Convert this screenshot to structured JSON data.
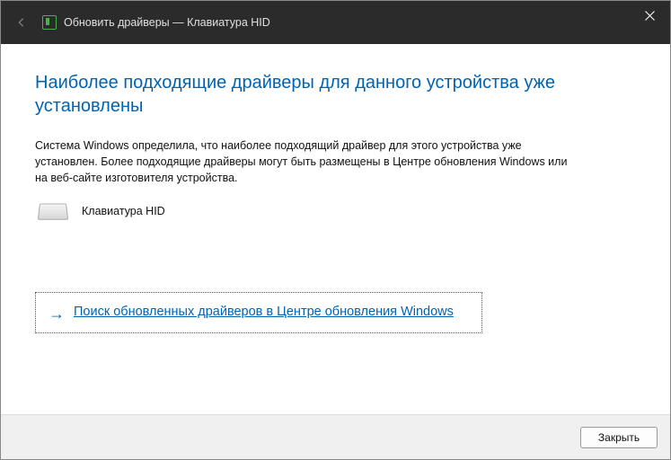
{
  "titlebar": {
    "title": "Обновить драйверы — Клавиатура HID"
  },
  "main": {
    "heading": "Наиболее подходящие драйверы для данного устройства уже установлены",
    "description": "Система Windows определила, что наиболее подходящий драйвер для этого устройства уже установлен. Более подходящие драйверы могут быть размещены в Центре обновления Windows или на веб-сайте изготовителя устройства.",
    "device_name": "Клавиатура HID",
    "search_link": "Поиск обновленных драйверов в Центре обновления Windows"
  },
  "footer": {
    "close_label": "Закрыть"
  }
}
